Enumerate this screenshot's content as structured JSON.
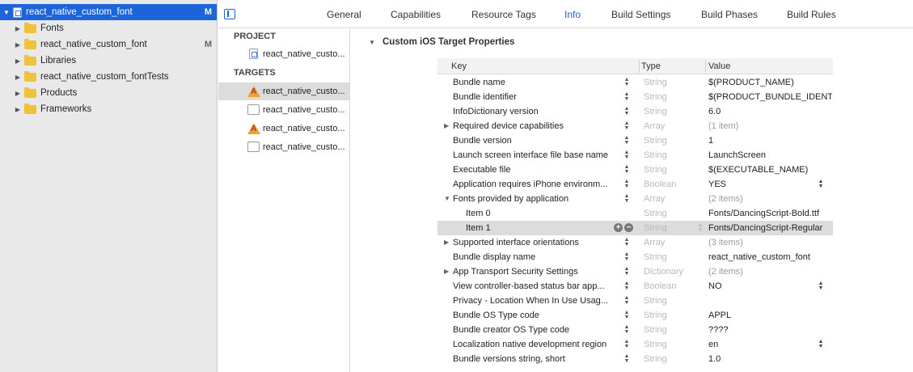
{
  "navigator": {
    "items": [
      {
        "label": "react_native_custom_font",
        "badge": "M",
        "icon": "project-file-icon",
        "selected": true
      },
      {
        "label": "Fonts",
        "badge": "",
        "icon": "folder-icon"
      },
      {
        "label": "react_native_custom_font",
        "badge": "M",
        "icon": "folder-icon"
      },
      {
        "label": "Libraries",
        "badge": "",
        "icon": "folder-icon"
      },
      {
        "label": "react_native_custom_fontTests",
        "badge": "",
        "icon": "folder-icon"
      },
      {
        "label": "Products",
        "badge": "",
        "icon": "folder-icon"
      },
      {
        "label": "Frameworks",
        "badge": "",
        "icon": "folder-icon"
      }
    ]
  },
  "tabs": [
    "General",
    "Capabilities",
    "Resource Tags",
    "Info",
    "Build Settings",
    "Build Phases",
    "Build Rules"
  ],
  "active_tab": "Info",
  "targets_panel": {
    "project_header": "PROJECT",
    "project_item": "react_native_custo...",
    "targets_header": "TARGETS",
    "targets": [
      {
        "label": "react_native_custo...",
        "icon": "app-target-icon",
        "selected": true
      },
      {
        "label": "react_native_custo...",
        "icon": "test-target-icon"
      },
      {
        "label": "react_native_custo...",
        "icon": "app-target-icon"
      },
      {
        "label": "react_native_custo...",
        "icon": "test-target-icon"
      }
    ]
  },
  "properties": {
    "section_title": "Custom iOS Target Properties",
    "columns": {
      "key": "Key",
      "type": "Type",
      "value": "Value"
    },
    "rows": [
      {
        "key": "Bundle name",
        "type": "String",
        "value": "$(PRODUCT_NAME)"
      },
      {
        "key": "Bundle identifier",
        "type": "String",
        "value": "$(PRODUCT_BUNDLE_IDENT"
      },
      {
        "key": "InfoDictionary version",
        "type": "String",
        "value": "6.0"
      },
      {
        "key": "Required device capabilities",
        "type": "Array",
        "value": "(1 item)",
        "expandable": true,
        "expanded": false
      },
      {
        "key": "Bundle version",
        "type": "String",
        "value": "1"
      },
      {
        "key": "Launch screen interface file base name",
        "type": "String",
        "value": "LaunchScreen"
      },
      {
        "key": "Executable file",
        "type": "String",
        "value": "$(EXECUTABLE_NAME)"
      },
      {
        "key": "Application requires iPhone environm...",
        "type": "Boolean",
        "value": "YES",
        "popup": true
      },
      {
        "key": "Fonts provided by application",
        "type": "Array",
        "value": "(2 items)",
        "expandable": true,
        "expanded": true
      },
      {
        "key": "Item 0",
        "type": "String",
        "value": "Fonts/DancingScript-Bold.ttf",
        "child": true
      },
      {
        "key": "Item 1",
        "type": "String",
        "value": "Fonts/DancingScript-Regular",
        "child": true,
        "selected": true
      },
      {
        "key": "Supported interface orientations",
        "type": "Array",
        "value": "(3 items)",
        "expandable": true,
        "expanded": false
      },
      {
        "key": "Bundle display name",
        "type": "String",
        "value": "react_native_custom_font"
      },
      {
        "key": "App Transport Security Settings",
        "type": "Dictionary",
        "value": "(2 items)",
        "expandable": true,
        "expanded": false
      },
      {
        "key": "View controller-based status bar app...",
        "type": "Boolean",
        "value": "NO",
        "popup": true
      },
      {
        "key": "Privacy - Location When In Use Usag...",
        "type": "String",
        "value": ""
      },
      {
        "key": "Bundle OS Type code",
        "type": "String",
        "value": "APPL"
      },
      {
        "key": "Bundle creator OS Type code",
        "type": "String",
        "value": "????"
      },
      {
        "key": "Localization native development region",
        "type": "String",
        "value": "en",
        "popup": true
      },
      {
        "key": "Bundle versions string, short",
        "type": "String",
        "value": "1.0"
      }
    ]
  }
}
